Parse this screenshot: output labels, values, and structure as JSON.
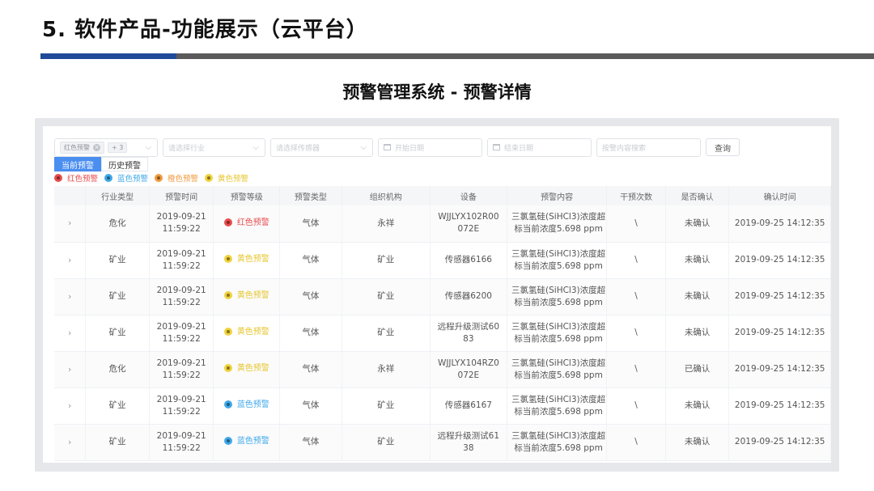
{
  "slide": {
    "title": "5. 软件产品-功能展示（云平台）",
    "subtitle": "预警管理系统 - 预警详情"
  },
  "filters": {
    "level_tag": "红色预警",
    "more_tag": "+ 3",
    "industry_placeholder": "请选择行业",
    "sensor_placeholder": "请选择传感器",
    "start_placeholder": "开始日期",
    "end_placeholder": "结束日期",
    "search_placeholder": "按警内容搜索",
    "query_label": "查询"
  },
  "tabs": [
    "当前预警",
    "历史预警"
  ],
  "legend": [
    {
      "label": "红色预警",
      "color": "#e84c4c"
    },
    {
      "label": "蓝色预警",
      "color": "#3fa8e8"
    },
    {
      "label": "橙色预警",
      "color": "#f29a3d"
    },
    {
      "label": "黄色预警",
      "color": "#f0d23c"
    }
  ],
  "colors": {
    "red": "#e84c4c",
    "blue": "#3fa8e8",
    "orange": "#f29a3d",
    "yellow": "#f0d23c",
    "accent": "#4a8ef0"
  },
  "table": {
    "headers": [
      "",
      "行业类型",
      "预警时间",
      "预警等级",
      "预警类型",
      "组织机构",
      "设备",
      "预警内容",
      "干预次数",
      "是否确认",
      "确认时间"
    ],
    "rows": [
      {
        "industry": "危化",
        "time1": "2019-09-21",
        "time2": "11:59:22",
        "level": "红色预警",
        "level_color": "red",
        "type": "气体",
        "org": "永祥",
        "device": "WJJLYX102R00072E",
        "content": "三氯氢硅(SiHCl3)浓度超标当前浓度5.698 ppm",
        "count": "\\",
        "confirmed": "未确认",
        "confirm_time": "2019-09-25 14:12:35"
      },
      {
        "industry": "矿业",
        "time1": "2019-09-21",
        "time2": "11:59:22",
        "level": "黄色预警",
        "level_color": "yellow",
        "type": "气体",
        "org": "矿业",
        "device": "传感器6166",
        "content": "三氯氢硅(SiHCl3)浓度超标当前浓度5.698 ppm",
        "count": "\\",
        "confirmed": "未确认",
        "confirm_time": "2019-09-25 14:12:35"
      },
      {
        "industry": "矿业",
        "time1": "2019-09-21",
        "time2": "11:59:22",
        "level": "黄色预警",
        "level_color": "yellow",
        "type": "气体",
        "org": "矿业",
        "device": "传感器6200",
        "content": "三氯氢硅(SiHCl3)浓度超标当前浓度5.698 ppm",
        "count": "\\",
        "confirmed": "未确认",
        "confirm_time": "2019-09-25 14:12:35"
      },
      {
        "industry": "矿业",
        "time1": "2019-09-21",
        "time2": "11:59:22",
        "level": "黄色预警",
        "level_color": "yellow",
        "type": "气体",
        "org": "矿业",
        "device": "远程升级测试6083",
        "content": "三氯氢硅(SiHCl3)浓度超标当前浓度5.698 ppm",
        "count": "\\",
        "confirmed": "未确认",
        "confirm_time": "2019-09-25 14:12:35"
      },
      {
        "industry": "危化",
        "time1": "2019-09-21",
        "time2": "11:59:22",
        "level": "黄色预警",
        "level_color": "yellow",
        "type": "气体",
        "org": "永祥",
        "device": "WJJLYX104RZ0072E",
        "content": "三氯氢硅(SiHCl3)浓度超标当前浓度5.698 ppm",
        "count": "\\",
        "confirmed": "已确认",
        "confirm_time": "2019-09-25 14:12:35"
      },
      {
        "industry": "矿业",
        "time1": "2019-09-21",
        "time2": "11:59:22",
        "level": "蓝色预警",
        "level_color": "blue",
        "type": "气体",
        "org": "矿业",
        "device": "传感器6167",
        "content": "三氯氢硅(SiHCl3)浓度超标当前浓度5.698 ppm",
        "count": "\\",
        "confirmed": "未确认",
        "confirm_time": "2019-09-25 14:12:35"
      },
      {
        "industry": "矿业",
        "time1": "2019-09-21",
        "time2": "11:59:22",
        "level": "蓝色预警",
        "level_color": "blue",
        "type": "气体",
        "org": "矿业",
        "device": "远程升级测试6138",
        "content": "三氯氢硅(SiHCl3)浓度超标当前浓度5.698 ppm",
        "count": "\\",
        "confirmed": "未确认",
        "confirm_time": "2019-09-25 14:12:35"
      }
    ]
  }
}
